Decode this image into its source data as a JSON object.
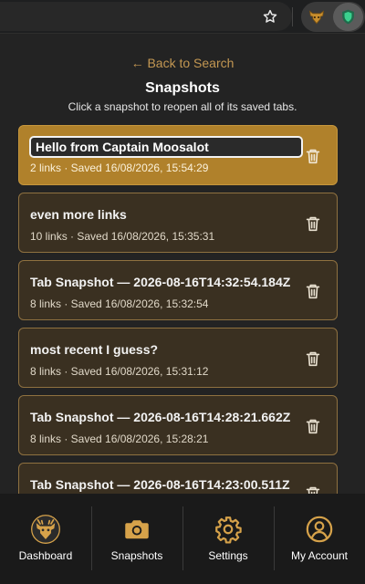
{
  "browser": {
    "star_icon": "star-icon",
    "extensions": [
      "moose-extension-icon",
      "shield-extension-icon"
    ]
  },
  "header": {
    "back_label": "← Back to Search",
    "title": "Snapshots",
    "subtitle": "Click a snapshot to reopen all of its saved tabs."
  },
  "snapshots": [
    {
      "title": "Hello from Captain Moosalot",
      "meta": "2 links · Saved 16/08/2026, 15:54:29",
      "editing": true
    },
    {
      "title": "even more links",
      "meta": "10 links · Saved 16/08/2026, 15:35:31"
    },
    {
      "title": "Tab Snapshot — 2026-08-16T14:32:54.184Z",
      "meta": "8 links · Saved 16/08/2026, 15:32:54"
    },
    {
      "title": "most recent I guess?",
      "meta": "8 links · Saved 16/08/2026, 15:31:12"
    },
    {
      "title": "Tab Snapshot — 2026-08-16T14:28:21.662Z",
      "meta": "8 links · Saved 16/08/2026, 15:28:21"
    },
    {
      "title": "Tab Snapshot — 2026-08-16T14:23:00.511Z",
      "meta": ""
    }
  ],
  "nav": {
    "dashboard": "Dashboard",
    "snapshots": "Snapshots",
    "settings": "Settings",
    "account": "My Account"
  },
  "colors": {
    "accent": "#c39752",
    "active_card": "#b0812b",
    "card": "#3a3021",
    "card_border": "#8f7140",
    "nav_icon": "#d6a24a"
  }
}
